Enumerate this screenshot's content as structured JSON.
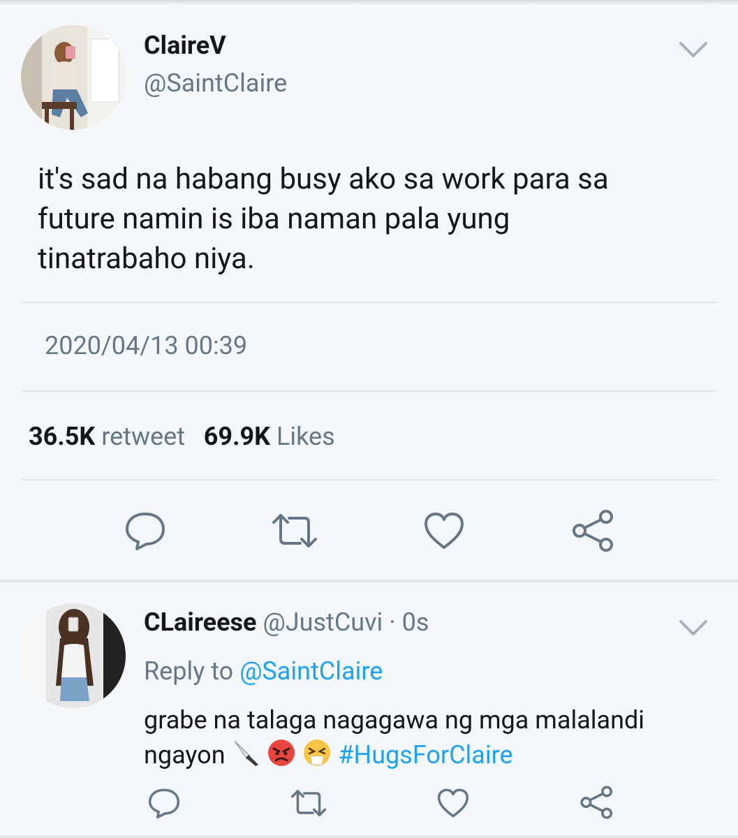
{
  "tweet": {
    "display_name": "ClaireV",
    "handle": "@SaintClaire",
    "text": "it's sad na habang busy ako sa work para sa future namin is iba naman pala yung tinatrabaho niya.",
    "timestamp": "2020/04/13 00:39",
    "retweet_count": "36.5K",
    "retweet_label": "retweet",
    "likes_count": "69.9K",
    "likes_label": "Likes"
  },
  "reply": {
    "display_name": "CLaireese",
    "handle": "@JustCuvi",
    "separator": "·",
    "time": "0s",
    "reply_to_label": "Reply to",
    "reply_to_handle": "@SaintClaire",
    "text": "grabe na talaga nagagawa ng mga malalandi ngayon",
    "emojis": [
      "knife-emoji",
      "angry-face-emoji",
      "tired-face-emoji"
    ],
    "hashtag": "#HugsForClaire"
  },
  "icons": {
    "actions": [
      "reply-icon",
      "retweet-icon",
      "like-icon",
      "share-icon"
    ],
    "menu": "chevron-down-icon"
  },
  "colors": {
    "link_blue": "#1da1f2",
    "secondary_text": "#657786",
    "primary_text": "#14171a",
    "background": "#f5f8fa"
  }
}
